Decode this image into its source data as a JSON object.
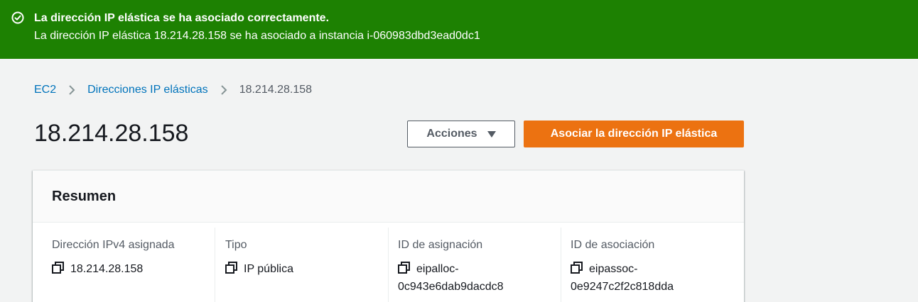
{
  "flash": {
    "title": "La dirección IP elástica se ha asociado correctamente.",
    "message": "La dirección IP elástica 18.214.28.158 se ha asociado a instancia i-060983dbd3ead0dc1",
    "icon": "success-check-icon",
    "color": "#1d8102"
  },
  "breadcrumb": {
    "items": [
      "EC2",
      "Direcciones IP elásticas",
      "18.214.28.158"
    ]
  },
  "page": {
    "title": "18.214.28.158"
  },
  "actions": {
    "actions_label": "Acciones",
    "associate_label": "Asociar la dirección IP elástica",
    "primary_color": "#ec7211"
  },
  "summary": {
    "title": "Resumen",
    "fields": [
      {
        "label": "Dirección IPv4 asignada",
        "value": "18.214.28.158"
      },
      {
        "label": "Tipo",
        "value": "IP pública"
      },
      {
        "label": "ID de asignación",
        "value_line1": "eipalloc-",
        "value_line2": "0c943e6dab9dacdc8"
      },
      {
        "label": "ID de asociación",
        "value_line1": "eipassoc-",
        "value_line2": "0e9247c2f2c818dda"
      }
    ]
  }
}
